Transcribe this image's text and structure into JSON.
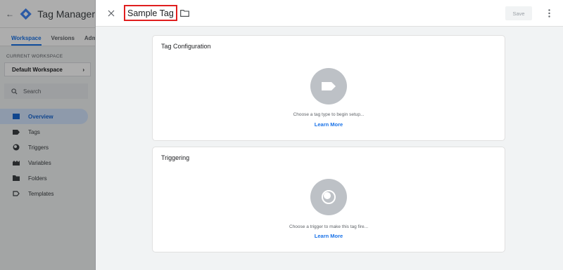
{
  "background_app": {
    "product_name": "Tag Manager",
    "tabs": [
      "Workspace",
      "Versions",
      "Admin"
    ],
    "current_workspace_label": "CURRENT WORKSPACE",
    "workspace_name": "Default Workspace",
    "search_placeholder": "Search",
    "nav": [
      {
        "label": "Overview",
        "icon": "overview-icon",
        "active": true
      },
      {
        "label": "Tags",
        "icon": "tag-icon",
        "active": false
      },
      {
        "label": "Triggers",
        "icon": "trigger-icon",
        "active": false
      },
      {
        "label": "Variables",
        "icon": "variables-icon",
        "active": false
      },
      {
        "label": "Folders",
        "icon": "folder-icon",
        "active": false
      },
      {
        "label": "Templates",
        "icon": "templates-icon",
        "active": false
      }
    ]
  },
  "editor": {
    "title": "Sample Tag",
    "save_label": "Save",
    "tag_config": {
      "title": "Tag Configuration",
      "hint": "Choose a tag type to begin setup...",
      "link": "Learn More"
    },
    "triggering": {
      "title": "Triggering",
      "hint": "Choose a trigger to make this tag fire...",
      "link": "Learn More"
    }
  },
  "colors": {
    "accent": "#1a73e8",
    "highlight_box": "#e01e1e",
    "placeholder_circle": "#bdc1c6"
  }
}
